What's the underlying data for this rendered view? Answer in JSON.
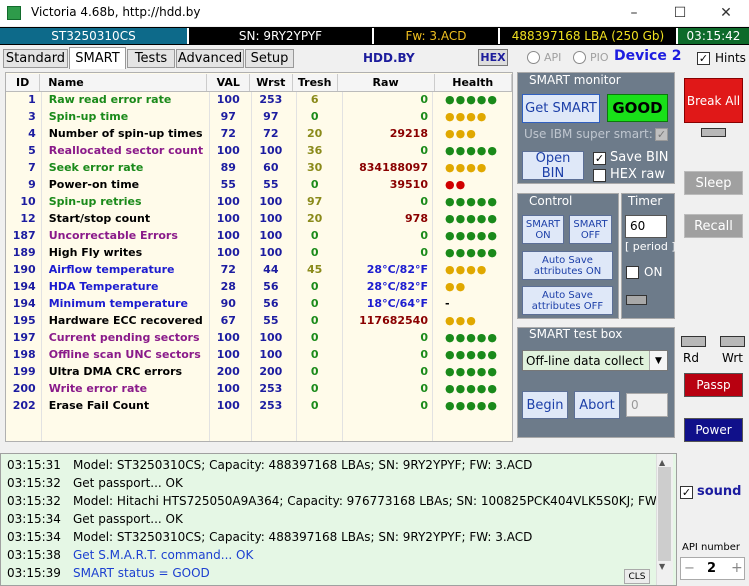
{
  "title": "Victoria 4.68b, http://hdd.by",
  "info": {
    "model": "ST3250310CS",
    "sn": "SN: 9RY2YPYF",
    "fw": "Fw: 3.ACD",
    "lba": "488397168 LBA (250 Gb)",
    "time": "03:15:42"
  },
  "tabs": [
    "Standard",
    "SMART",
    "Tests",
    "Advanced",
    "Setup"
  ],
  "active_tab": "SMART",
  "hddby": "HDD.BY",
  "hex": "HEX",
  "api_label": "API",
  "pio_label": "PIO",
  "device": "Device 2",
  "hints": "Hints",
  "columns": [
    "ID",
    "Name",
    "VAL",
    "Wrst",
    "Tresh",
    "Raw",
    "Health"
  ],
  "colors": {
    "green": "#1a8a1a",
    "purple": "#8a1a8a",
    "black": "#000000",
    "blue": "#1c1cd0",
    "red": "#8a0000",
    "yellow": "#e0a800",
    "redhealth": "#d00000"
  },
  "rows": [
    {
      "id": "1",
      "name": "Raw read error rate",
      "val": "100",
      "wrst": "253",
      "tr": "6",
      "raw": "0",
      "health": "●●●●●",
      "nc": "green",
      "rc": "green",
      "hc": "green"
    },
    {
      "id": "3",
      "name": "Spin-up time",
      "val": "97",
      "wrst": "97",
      "tr": "0",
      "raw": "0",
      "health": "●●●●",
      "nc": "green",
      "rc": "green",
      "hc": "yellow"
    },
    {
      "id": "4",
      "name": "Number of spin-up times",
      "val": "72",
      "wrst": "72",
      "tr": "20",
      "raw": "29218",
      "health": "●●●",
      "nc": "black",
      "rc": "red",
      "hc": "yellow"
    },
    {
      "id": "5",
      "name": "Reallocated sector count",
      "val": "100",
      "wrst": "100",
      "tr": "36",
      "raw": "0",
      "health": "●●●●●",
      "nc": "purple",
      "rc": "green",
      "hc": "green"
    },
    {
      "id": "7",
      "name": "Seek error rate",
      "val": "89",
      "wrst": "60",
      "tr": "30",
      "raw": "834188097",
      "health": "●●●●",
      "nc": "green",
      "rc": "red",
      "hc": "yellow"
    },
    {
      "id": "9",
      "name": "Power-on time",
      "val": "55",
      "wrst": "55",
      "tr": "0",
      "raw": "39510",
      "health": "●●",
      "nc": "black",
      "rc": "red",
      "hc": "redhealth"
    },
    {
      "id": "10",
      "name": "Spin-up retries",
      "val": "100",
      "wrst": "100",
      "tr": "97",
      "raw": "0",
      "health": "●●●●●",
      "nc": "green",
      "rc": "green",
      "hc": "green"
    },
    {
      "id": "12",
      "name": "Start/stop count",
      "val": "100",
      "wrst": "100",
      "tr": "20",
      "raw": "978",
      "health": "●●●●●",
      "nc": "black",
      "rc": "red",
      "hc": "green"
    },
    {
      "id": "187",
      "name": "Uncorrectable Errors",
      "val": "100",
      "wrst": "100",
      "tr": "0",
      "raw": "0",
      "health": "●●●●●",
      "nc": "purple",
      "rc": "green",
      "hc": "green"
    },
    {
      "id": "189",
      "name": "High Fly writes",
      "val": "100",
      "wrst": "100",
      "tr": "0",
      "raw": "0",
      "health": "●●●●●",
      "nc": "black",
      "rc": "green",
      "hc": "green"
    },
    {
      "id": "190",
      "name": "Airflow temperature",
      "val": "72",
      "wrst": "44",
      "tr": "45",
      "raw": "28°C/82°F",
      "health": "●●●●",
      "nc": "blue",
      "rc": "blue",
      "hc": "yellow"
    },
    {
      "id": "194",
      "name": "HDA Temperature",
      "val": "28",
      "wrst": "56",
      "tr": "0",
      "raw": "28°C/82°F",
      "health": "●●",
      "nc": "blue",
      "rc": "blue",
      "hc": "yellow"
    },
    {
      "id": "194",
      "name": "Minimum temperature",
      "val": "90",
      "wrst": "56",
      "tr": "0",
      "raw": "18°C/64°F",
      "health": "-",
      "nc": "blue",
      "rc": "blue",
      "hc": "black"
    },
    {
      "id": "195",
      "name": "Hardware ECC recovered",
      "val": "67",
      "wrst": "55",
      "tr": "0",
      "raw": "117682540",
      "health": "●●●",
      "nc": "black",
      "rc": "red",
      "hc": "yellow"
    },
    {
      "id": "197",
      "name": "Current pending sectors",
      "val": "100",
      "wrst": "100",
      "tr": "0",
      "raw": "0",
      "health": "●●●●●",
      "nc": "purple",
      "rc": "green",
      "hc": "green"
    },
    {
      "id": "198",
      "name": "Offline scan UNC sectors",
      "val": "100",
      "wrst": "100",
      "tr": "0",
      "raw": "0",
      "health": "●●●●●",
      "nc": "purple",
      "rc": "green",
      "hc": "green"
    },
    {
      "id": "199",
      "name": "Ultra DMA CRC errors",
      "val": "200",
      "wrst": "200",
      "tr": "0",
      "raw": "0",
      "health": "●●●●●",
      "nc": "black",
      "rc": "green",
      "hc": "green"
    },
    {
      "id": "200",
      "name": "Write error rate",
      "val": "100",
      "wrst": "253",
      "tr": "0",
      "raw": "0",
      "health": "●●●●●",
      "nc": "purple",
      "rc": "green",
      "hc": "green"
    },
    {
      "id": "202",
      "name": "Erase Fail Count",
      "val": "100",
      "wrst": "253",
      "tr": "0",
      "raw": "0",
      "health": "●●●●●",
      "nc": "black",
      "rc": "green",
      "hc": "green"
    }
  ],
  "smart_monitor": {
    "title": "SMART monitor",
    "get_smart": "Get SMART",
    "status": "GOOD",
    "ibm": "Use IBM super smart:",
    "open_bin": "Open BIN",
    "save_bin": "Save BIN",
    "hex_raw": "HEX raw"
  },
  "control": {
    "title": "Control",
    "smart_on": "SMART ON",
    "smart_off": "SMART OFF",
    "autosave_on": "Auto Save attributes ON",
    "autosave_off": "Auto Save attributes OFF"
  },
  "timer": {
    "title": "Timer",
    "value": "60",
    "period": "[ period ]",
    "on": "ON"
  },
  "test_box": {
    "title": "SMART test box",
    "selected": "Off-line data collect",
    "begin": "Begin",
    "abort": "Abort",
    "value": "0"
  },
  "right": {
    "break_all": "Break All",
    "sleep": "Sleep",
    "recall": "Recall",
    "rd": "Rd",
    "wrt": "Wrt",
    "passp": "Passp",
    "power": "Power",
    "sound": "sound",
    "api_number": "API number",
    "api_value": "2"
  },
  "log": [
    {
      "t": "03:15:31",
      "m": "Model: ST3250310CS; Capacity: 488397168 LBAs; SN: 9RY2YPYF; FW: 3.ACD",
      "blue": false
    },
    {
      "t": "03:15:32",
      "m": "Get passport... OK",
      "blue": false
    },
    {
      "t": "03:15:32",
      "m": "Model: Hitachi HTS725050A9A364; Capacity: 976773168 LBAs; SN: 100825PCK404VLK5S0KJ; FW...",
      "blue": false
    },
    {
      "t": "03:15:34",
      "m": "Get passport... OK",
      "blue": false
    },
    {
      "t": "03:15:34",
      "m": "Model: ST3250310CS; Capacity: 488397168 LBAs; SN: 9RY2YPYF; FW: 3.ACD",
      "blue": false
    },
    {
      "t": "03:15:38",
      "m": "Get S.M.A.R.T. command... OK",
      "blue": true
    },
    {
      "t": "03:15:39",
      "m": "SMART status = GOOD",
      "blue": true
    }
  ],
  "cls": "CLS"
}
